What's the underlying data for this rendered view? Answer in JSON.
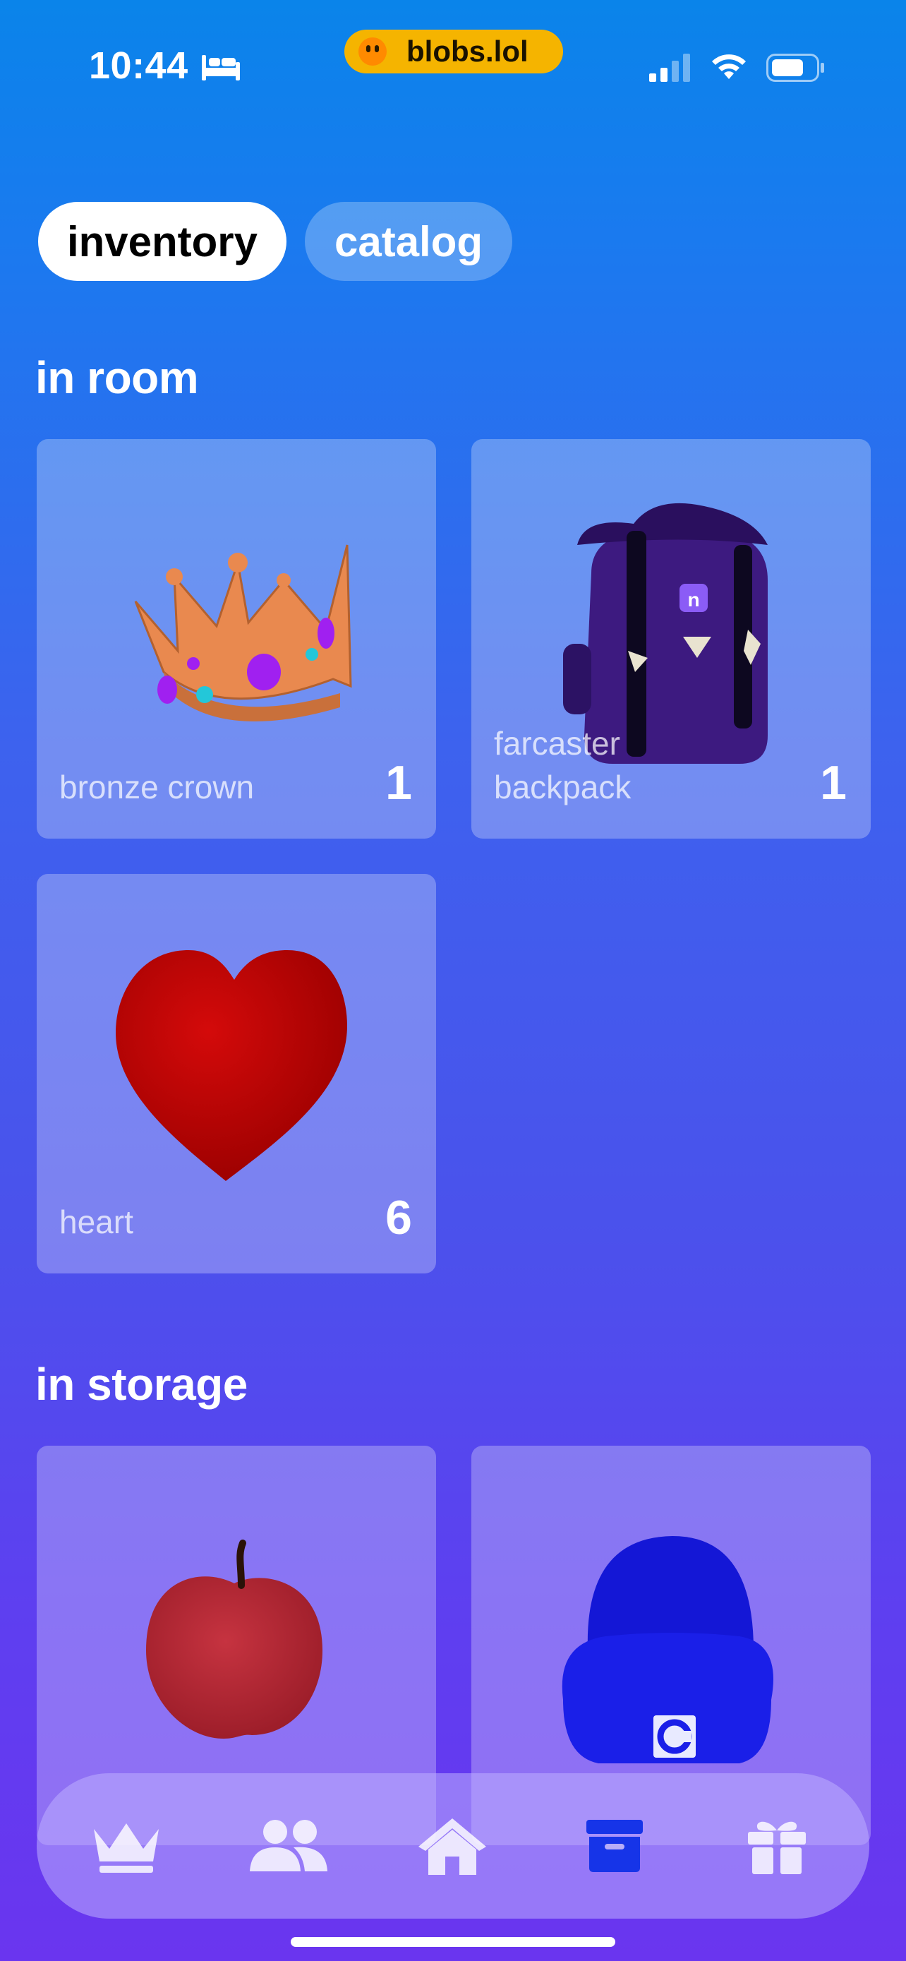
{
  "status_bar": {
    "time": "10:44",
    "sleep_icon": "bed-icon",
    "pill_label": "blobs.lol",
    "pill_color": "#f5b400",
    "icons": [
      "cellular-signal-icon",
      "wifi-icon",
      "battery-icon"
    ]
  },
  "tabs": {
    "inventory": "inventory",
    "catalog": "catalog",
    "active": "inventory"
  },
  "sections": {
    "in_room": {
      "title": "in room",
      "items": [
        {
          "name": "bronze crown",
          "count": "1",
          "icon": "crown-icon"
        },
        {
          "name": "farcaster backpack",
          "count": "1",
          "icon": "backpack-icon"
        },
        {
          "name": "heart",
          "count": "6",
          "icon": "heart-icon"
        }
      ]
    },
    "in_storage": {
      "title": "in storage",
      "items": [
        {
          "icon": "apple-icon"
        },
        {
          "icon": "beanie-icon"
        }
      ]
    }
  },
  "nav": {
    "items": [
      "crown-icon",
      "people-icon",
      "house-icon",
      "archive-box-icon",
      "gift-icon"
    ],
    "active": "archive-box-icon",
    "active_color": "#1634e8"
  }
}
